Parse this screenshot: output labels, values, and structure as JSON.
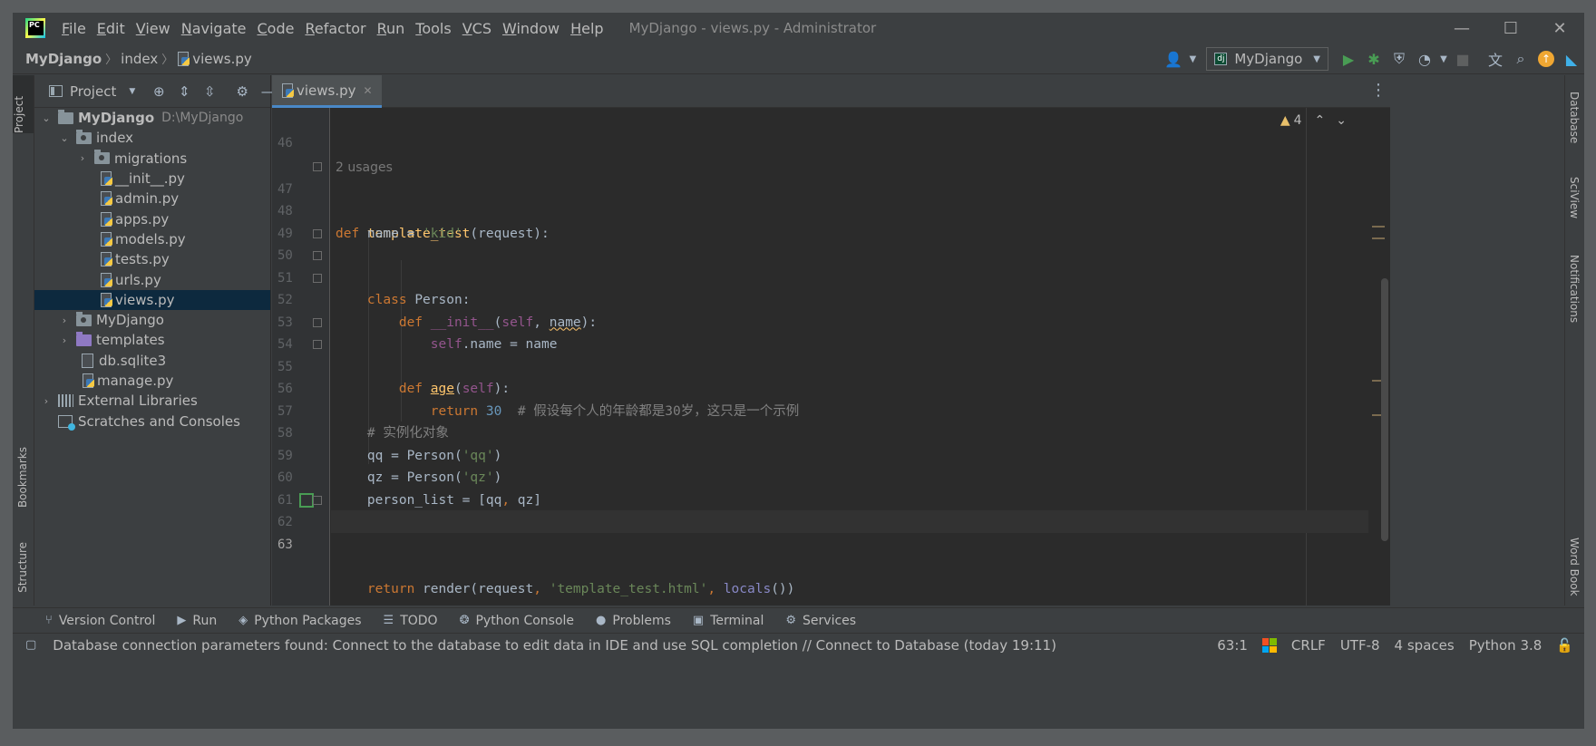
{
  "titlebar": {
    "menu": [
      "File",
      "Edit",
      "View",
      "Navigate",
      "Code",
      "Refactor",
      "Run",
      "Tools",
      "VCS",
      "Window",
      "Help"
    ],
    "window_title": "MyDjango - views.py - Administrator",
    "controls": {
      "minimize": "—",
      "maximize": "☐",
      "close": "✕"
    }
  },
  "navbar": {
    "breadcrumb": [
      "MyDjango",
      "index",
      "views.py"
    ],
    "run_config": "MyDjango"
  },
  "left_stripe": {
    "project": "Project",
    "bookmarks": "Bookmarks",
    "structure": "Structure"
  },
  "project_panel": {
    "title": "Project",
    "tree": [
      {
        "label": "MyDjango",
        "hint": "D:\\MyDjango",
        "type": "folder",
        "depth": 0,
        "expanded": true
      },
      {
        "label": "index",
        "type": "package",
        "depth": 1,
        "expanded": true
      },
      {
        "label": "migrations",
        "type": "package",
        "depth": 2,
        "expanded": false
      },
      {
        "label": "__init__.py",
        "type": "py",
        "depth": 3
      },
      {
        "label": "admin.py",
        "type": "py",
        "depth": 3
      },
      {
        "label": "apps.py",
        "type": "py",
        "depth": 3
      },
      {
        "label": "models.py",
        "type": "py",
        "depth": 3
      },
      {
        "label": "tests.py",
        "type": "py",
        "depth": 3
      },
      {
        "label": "urls.py",
        "type": "py",
        "depth": 3
      },
      {
        "label": "views.py",
        "type": "py",
        "depth": 3,
        "selected": true
      },
      {
        "label": "MyDjango",
        "type": "package",
        "depth": 1,
        "expanded": false
      },
      {
        "label": "templates",
        "type": "template",
        "depth": 1,
        "expanded": false
      },
      {
        "label": "db.sqlite3",
        "type": "file",
        "depth": 2
      },
      {
        "label": "manage.py",
        "type": "py",
        "depth": 2
      },
      {
        "label": "External Libraries",
        "type": "libs",
        "depth": 0,
        "expanded": false
      },
      {
        "label": "Scratches and Consoles",
        "type": "scratch",
        "depth": 0
      }
    ]
  },
  "editor": {
    "tab": "views.py",
    "inspection_count": "4",
    "usages": "2 usages",
    "lines": [
      {
        "n": "46",
        "code": ""
      },
      {
        "n": "47",
        "code": "def template_test(request):"
      },
      {
        "n": "48",
        "code": "    name = 'kid'"
      },
      {
        "n": "49",
        "code": ""
      },
      {
        "n": "50",
        "code": "    class Person:"
      },
      {
        "n": "51",
        "code": "        def __init__(self, name):"
      },
      {
        "n": "52",
        "code": "            self.name = name"
      },
      {
        "n": "53",
        "code": ""
      },
      {
        "n": "54",
        "code": "        def age(self):"
      },
      {
        "n": "55",
        "code": "            return 30  # 假设每个人的年龄都是30岁，这只是一个示例"
      },
      {
        "n": "56",
        "code": ""
      },
      {
        "n": "57",
        "code": "    # 实例化对象"
      },
      {
        "n": "58",
        "code": "    qq = Person('qq')"
      },
      {
        "n": "59",
        "code": "    qz = Person('qz')"
      },
      {
        "n": "60",
        "code": "    person_list = [qq, qz]"
      },
      {
        "n": "61",
        "code": ""
      },
      {
        "n": "62",
        "code": "    return render(request, 'template_test.html', locals())"
      },
      {
        "n": "63",
        "code": ""
      }
    ]
  },
  "right_stripe": {
    "database": "Database",
    "sciview": "SciView",
    "notifications": "Notifications",
    "wordbook": "Word Book"
  },
  "bottom_tools": [
    "Version Control",
    "Run",
    "Python Packages",
    "TODO",
    "Python Console",
    "Problems",
    "Terminal",
    "Services"
  ],
  "statusbar": {
    "message": "Database connection parameters found: Connect to the database to edit data in IDE and use SQL completion // Connect to Database (today 19:11)",
    "position": "63:1",
    "line_ending": "CRLF",
    "encoding": "UTF-8",
    "indent": "4 spaces",
    "interpreter": "Python 3.8"
  }
}
